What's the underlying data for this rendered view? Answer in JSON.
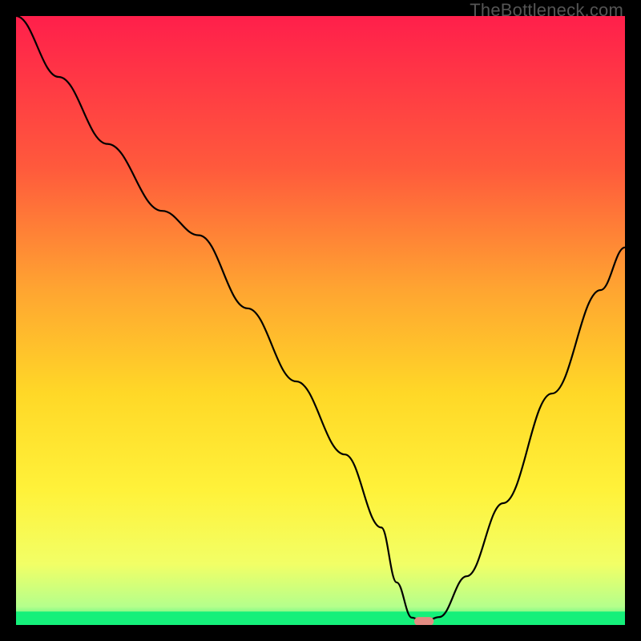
{
  "watermark": "TheBottleneck.com",
  "chart_data": {
    "type": "line",
    "title": "",
    "xlabel": "",
    "ylabel": "",
    "xlim": [
      0,
      100
    ],
    "ylim": [
      0,
      100
    ],
    "grid": false,
    "legend": false,
    "background_gradient": [
      {
        "y": 100,
        "color": "#ff1f4b"
      },
      {
        "y": 75,
        "color": "#ff5a3c"
      },
      {
        "y": 55,
        "color": "#ffa531"
      },
      {
        "y": 38,
        "color": "#ffd827"
      },
      {
        "y": 22,
        "color": "#fff23a"
      },
      {
        "y": 10,
        "color": "#f2ff66"
      },
      {
        "y": 3,
        "color": "#b4ff8c"
      },
      {
        "y": 0,
        "color": "#15f07a"
      }
    ],
    "bottom_band_color": "#15f07a",
    "series": [
      {
        "name": "bottleneck-curve",
        "color": "#000000",
        "x": [
          0,
          7,
          15,
          24,
          30,
          38,
          46,
          54,
          60,
          62.5,
          65,
          67,
          69.5,
          74,
          80,
          88,
          96,
          100
        ],
        "y": [
          100,
          90,
          79,
          68,
          64,
          52,
          40,
          28,
          16,
          7,
          1.2,
          0.5,
          1.3,
          8,
          20,
          38,
          55,
          62
        ]
      }
    ],
    "marker": {
      "shape": "pill",
      "x": 67,
      "y": 0.6,
      "width": 3.2,
      "height": 1.4,
      "color": "#e38b82"
    }
  }
}
